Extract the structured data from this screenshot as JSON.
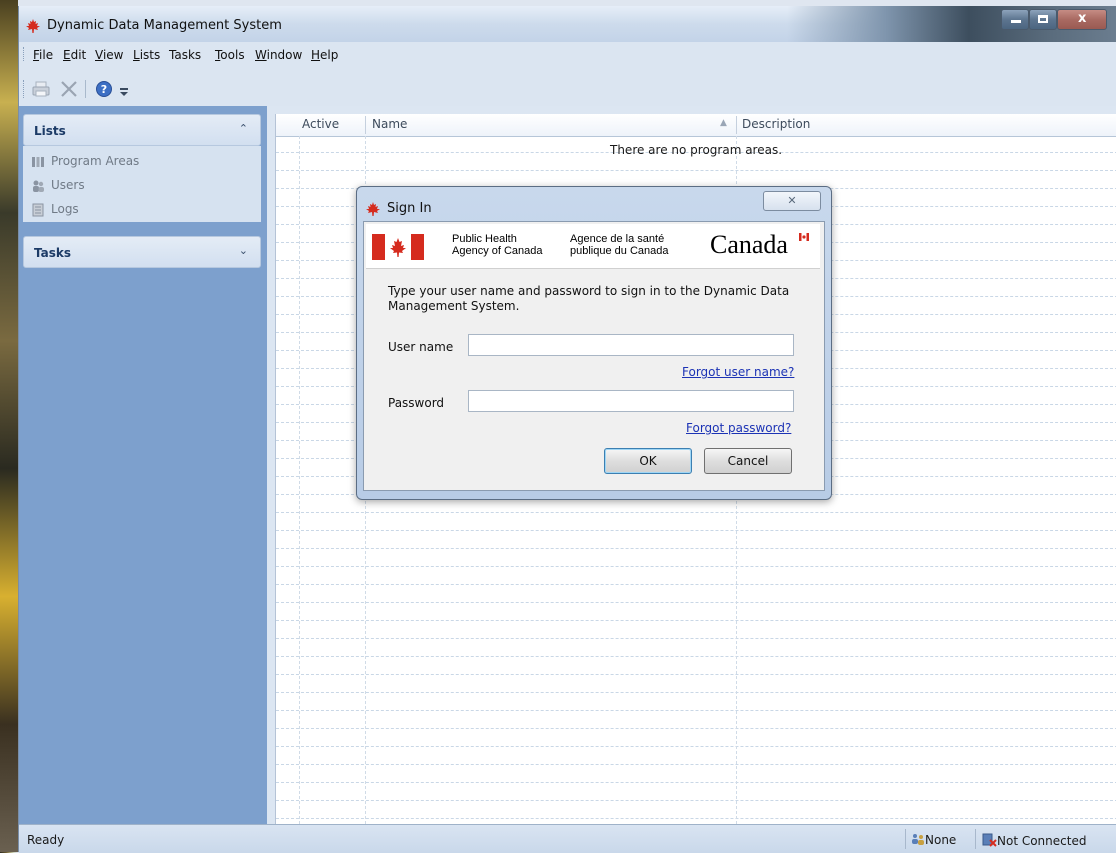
{
  "window": {
    "title": "Dynamic Data Management System",
    "controls": [
      "minimize",
      "maximize",
      "close"
    ]
  },
  "menubar": {
    "items": [
      {
        "label": "File",
        "mnemonic": "F"
      },
      {
        "label": "Edit",
        "mnemonic": "E"
      },
      {
        "label": "View",
        "mnemonic": "V"
      },
      {
        "label": "Lists",
        "mnemonic": "L"
      },
      {
        "label": "Tasks",
        "mnemonic": ""
      },
      {
        "label": "Tools",
        "mnemonic": "T"
      },
      {
        "label": "Window",
        "mnemonic": "W"
      },
      {
        "label": "Help",
        "mnemonic": "H"
      }
    ]
  },
  "toolbar": {
    "icons": [
      "print-icon",
      "delete-icon",
      "help-icon",
      "toolbar-overflow-icon"
    ]
  },
  "left_panel": {
    "lists": {
      "header": "Lists",
      "items": [
        {
          "label": "Program Areas",
          "icon": "program-areas-icon"
        },
        {
          "label": "Users",
          "icon": "users-icon"
        },
        {
          "label": "Logs",
          "icon": "logs-icon"
        }
      ]
    },
    "tasks": {
      "header": "Tasks"
    }
  },
  "grid": {
    "columns": [
      "Active",
      "Name",
      "Description"
    ],
    "sorted_column": "Name",
    "empty_message": "There are no program areas."
  },
  "dialog": {
    "title": "Sign In",
    "banner": {
      "en_line1": "Public Health",
      "en_line2": "Agency of Canada",
      "fr_line1": "Agence de la santé",
      "fr_line2": "publique du Canada",
      "wordmark": "Canada"
    },
    "prompt": "Type your user name and password to sign in to the Dynamic Data Management System.",
    "username_label": "User name",
    "username_value": "",
    "forgot_username": "Forgot user name?",
    "password_label": "Password",
    "password_value": "",
    "forgot_password": "Forgot password?",
    "ok_label": "OK",
    "cancel_label": "Cancel"
  },
  "statusbar": {
    "ready": "Ready",
    "none": "None",
    "connection": "Not Connected"
  },
  "colors": {
    "accent_red": "#d52b1e",
    "link": "#1c33b5",
    "panel_blue": "#7da0cd"
  }
}
